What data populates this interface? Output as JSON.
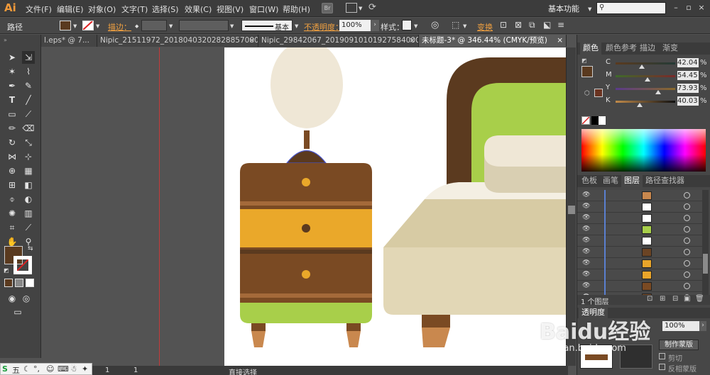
{
  "app": {
    "logo": "Ai",
    "workspace": "基本功能",
    "search_placeholder": ""
  },
  "menu": [
    "文件(F)",
    "编辑(E)",
    "对象(O)",
    "文字(T)",
    "选择(S)",
    "效果(C)",
    "视图(V)",
    "窗口(W)",
    "帮助(H)"
  ],
  "menu_badges": {
    "br": "Br"
  },
  "controlbar": {
    "selection_label": "路径",
    "stroke_label": "描边：",
    "stroke_style": "基本",
    "opacity_label": "不透明度：",
    "opacity_value": "100%",
    "style_label": "样式：",
    "transform_label": "变换"
  },
  "tabs": [
    {
      "label": "l.eps* @ 7...",
      "active": false
    },
    {
      "label": "Nipic_21511972_20180403202828857000.ai*",
      "active": false
    },
    {
      "label": "Nipic_29842067_20190910101927584000.ai*",
      "active": false
    },
    {
      "label": "未标题-3* @ 346.44% (CMYK/预览)",
      "active": true
    }
  ],
  "tab_close": "×",
  "color_panel": {
    "tabs": [
      "颜色",
      "颜色参考",
      "描边",
      "渐变"
    ],
    "channels": [
      {
        "name": "C",
        "value": "42.04",
        "unit": "%"
      },
      {
        "name": "M",
        "value": "54.45",
        "unit": "%"
      },
      {
        "name": "Y",
        "value": "73.93",
        "unit": "%"
      },
      {
        "name": "K",
        "value": "40.03",
        "unit": "%"
      }
    ],
    "swatch_color": "#5a3a1f"
  },
  "layers_panel": {
    "tabs": [
      "色板",
      "画笔",
      "图层",
      "路径查找器"
    ],
    "rows": [
      {
        "thumb": "#c9884e"
      },
      {
        "thumb": "#ffffff"
      },
      {
        "thumb": "#ffffff"
      },
      {
        "thumb": "#a8cf4a"
      },
      {
        "thumb": "#ffffff"
      },
      {
        "thumb": "#6b4424"
      },
      {
        "thumb": "#e9a52a"
      },
      {
        "thumb": "#e9a52a"
      },
      {
        "thumb": "#7a4a23"
      },
      {
        "thumb": "#7a4a23"
      }
    ],
    "footer": "1 个图层"
  },
  "transparency_panel": {
    "title": "透明度",
    "opacity": "100%",
    "make_mask": "制作蒙版",
    "clip": "剪切",
    "invert_mask": "反相蒙版"
  },
  "status": {
    "zoom": "1",
    "page": "1",
    "tool": "直接选择"
  },
  "taskbar": {
    "ime": "五"
  },
  "watermark": {
    "main": "Baidu经验",
    "sub": "jingyan.baidu.com"
  },
  "colors": {
    "brown": "#7a4a23",
    "dark_brown": "#5b3a1f",
    "orange": "#eaa82a",
    "green": "#a8cf4a",
    "cream": "#efe7d6",
    "beige": "#d7cba4",
    "light_wood": "#c9884e"
  }
}
